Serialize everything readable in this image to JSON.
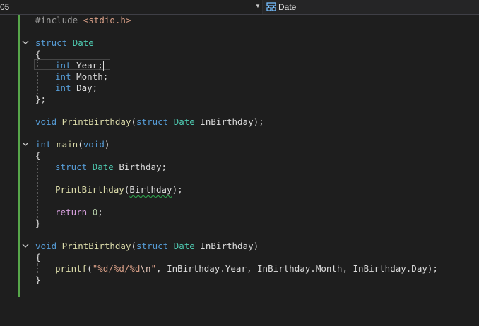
{
  "navbar": {
    "project_fragment": "05",
    "symbol_name": "Date"
  },
  "code": {
    "include_kw": "#include",
    "include_file": "<stdio.h>",
    "struct_kw": "struct",
    "date_type": "Date",
    "open_brace": "{",
    "close_brace": "}",
    "close_brace_semi": "};",
    "int_kw": "int",
    "void_kw": "void",
    "return_kw": "return",
    "member_year": "Year;",
    "member_month": "Month;",
    "member_day": "Day;",
    "print_fn": "PrintBirthday",
    "main_fn": "main",
    "printf_fn": "printf",
    "param_inbirthday": "InBirthday",
    "var_birthday": "Birthday",
    "zero": "0",
    "format_pre": "\"%d/%d/%d",
    "format_esc": "\\n",
    "format_post": "\"",
    "arg_year": "InBirthday.Year",
    "arg_month": "InBirthday.Month",
    "arg_day": "InBirthday.Day"
  }
}
